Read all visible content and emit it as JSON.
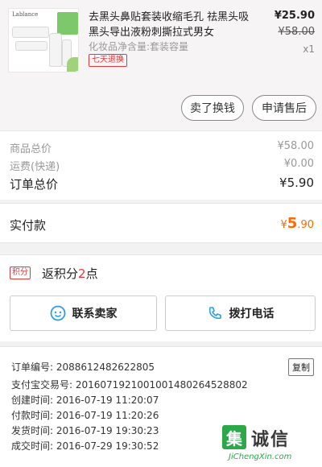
{
  "product": {
    "brand": "Lablance",
    "title": "去黑头鼻贴套装收缩毛孔 祛黑头吸黑头导出液粉刺撕拉式男女",
    "spec": "化妆品净含量:套装容量",
    "tag": "七天退换",
    "price": "¥25.90",
    "original_price": "¥58.00",
    "quantity": "x1",
    "actions": {
      "exchange": "卖了换钱",
      "after_sales": "申请售后"
    }
  },
  "summary": {
    "goods_total_label": "商品总价",
    "goods_total_value": "¥58.00",
    "shipping_label": "运费(快递)",
    "shipping_value": "¥0.00",
    "order_total_label": "订单总价",
    "order_total_value": "¥5.90"
  },
  "paid": {
    "label": "实付款",
    "currency": "¥",
    "main": "5",
    "decimal": ".90"
  },
  "points": {
    "badge": "积分",
    "text_prefix": "返积分",
    "amount": "2",
    "text_suffix": "点"
  },
  "contact": {
    "seller": "联系卖家",
    "phone": "拨打电话"
  },
  "info": {
    "order_no_label": "订单编号:",
    "order_no": "2088612482622805",
    "copy": "复制",
    "alipay_label": "支付宝交易号:",
    "alipay_no": "2016071921001001480264528802",
    "created_label": "创建时间:",
    "created": "2016-07-19 11:20:07",
    "paid_label": "付款时间:",
    "paid_time": "2016-07-19 11:20:26",
    "shipped_label": "发货时间:",
    "shipped": "2016-07-19 19:30:23",
    "done_label": "成交时间:",
    "done": "2016-07-29 19:30:52"
  },
  "watermark": {
    "mark": "集",
    "cn": "诚信",
    "url": "JiChengXin.com"
  },
  "colors": {
    "accent_red": "#e4393c",
    "paid_orange": "#ff6a00",
    "watermark_green": "#2aa84a"
  },
  "icons": {
    "seller": "chat-bubble-icon",
    "phone": "phone-icon"
  }
}
